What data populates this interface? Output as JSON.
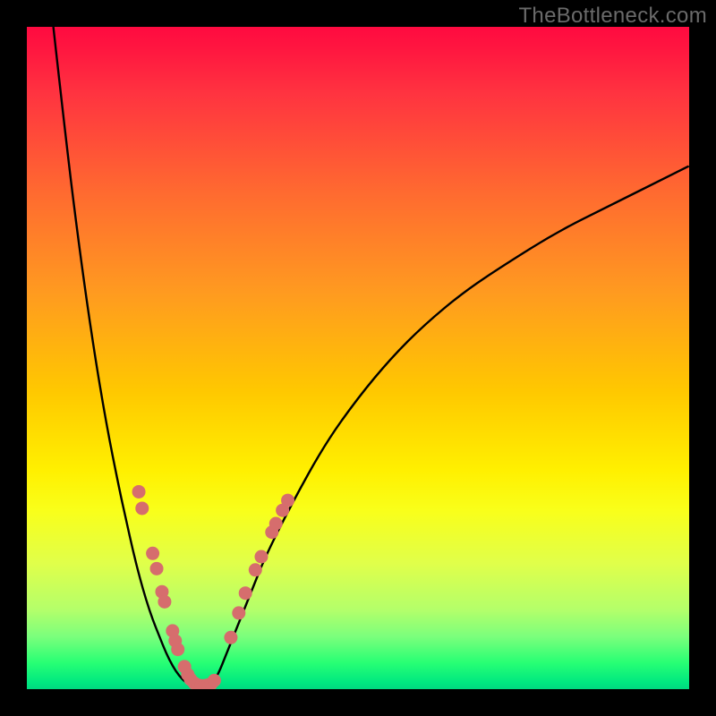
{
  "watermark": "TheBottleneck.com",
  "chart_data": {
    "type": "line",
    "title": "",
    "xlabel": "",
    "ylabel": "",
    "xlim": [
      0,
      100
    ],
    "ylim": [
      0,
      100
    ],
    "grid": false,
    "legend": false,
    "series": [
      {
        "name": "curve-left",
        "x": [
          4,
          6,
          8,
          10,
          12,
          14,
          15,
          16,
          17,
          18,
          19,
          20,
          21,
          22,
          23,
          24
        ],
        "y": [
          100,
          82,
          66,
          52,
          40,
          30,
          25.5,
          21,
          17,
          13.5,
          10.5,
          8,
          5.5,
          3.5,
          2,
          1
        ]
      },
      {
        "name": "curve-bottom",
        "x": [
          24,
          25,
          26,
          27,
          28
        ],
        "y": [
          1,
          0.5,
          0.3,
          0.4,
          0.8
        ]
      },
      {
        "name": "curve-right",
        "x": [
          28,
          29,
          30,
          32,
          34,
          36,
          40,
          45,
          50,
          55,
          60,
          66,
          72,
          80,
          88,
          96,
          100
        ],
        "y": [
          0.8,
          2.5,
          5,
          10,
          15,
          20,
          28,
          37,
          44,
          50,
          55,
          60,
          64,
          69,
          73,
          77,
          79
        ]
      }
    ],
    "scatter": {
      "name": "highlighted-points",
      "color": "#d66d6d",
      "points": [
        {
          "x": 16.9,
          "y": 29.8
        },
        {
          "x": 17.4,
          "y": 27.3
        },
        {
          "x": 19.0,
          "y": 20.5
        },
        {
          "x": 19.6,
          "y": 18.2
        },
        {
          "x": 20.4,
          "y": 14.7
        },
        {
          "x": 20.8,
          "y": 13.2
        },
        {
          "x": 22.0,
          "y": 8.8
        },
        {
          "x": 22.4,
          "y": 7.3
        },
        {
          "x": 22.8,
          "y": 6.0
        },
        {
          "x": 23.8,
          "y": 3.4
        },
        {
          "x": 24.3,
          "y": 2.2
        },
        {
          "x": 24.7,
          "y": 1.5
        },
        {
          "x": 25.3,
          "y": 0.9
        },
        {
          "x": 25.8,
          "y": 0.6
        },
        {
          "x": 26.3,
          "y": 0.5
        },
        {
          "x": 26.8,
          "y": 0.5
        },
        {
          "x": 27.3,
          "y": 0.6
        },
        {
          "x": 27.8,
          "y": 0.8
        },
        {
          "x": 28.3,
          "y": 1.3
        },
        {
          "x": 30.8,
          "y": 7.8
        },
        {
          "x": 32.0,
          "y": 11.5
        },
        {
          "x": 33.0,
          "y": 14.5
        },
        {
          "x": 34.5,
          "y": 18.0
        },
        {
          "x": 35.4,
          "y": 20.0
        },
        {
          "x": 37.0,
          "y": 23.7
        },
        {
          "x": 37.6,
          "y": 25.0
        },
        {
          "x": 38.6,
          "y": 27.0
        },
        {
          "x": 39.4,
          "y": 28.5
        }
      ]
    },
    "gradient_stops": [
      {
        "pos": 0.0,
        "color": "#ff0a40"
      },
      {
        "pos": 0.25,
        "color": "#ff6a30"
      },
      {
        "pos": 0.55,
        "color": "#ffc800"
      },
      {
        "pos": 0.73,
        "color": "#f9ff1a"
      },
      {
        "pos": 0.92,
        "color": "#7cff7c"
      },
      {
        "pos": 1.0,
        "color": "#00d880"
      }
    ]
  }
}
